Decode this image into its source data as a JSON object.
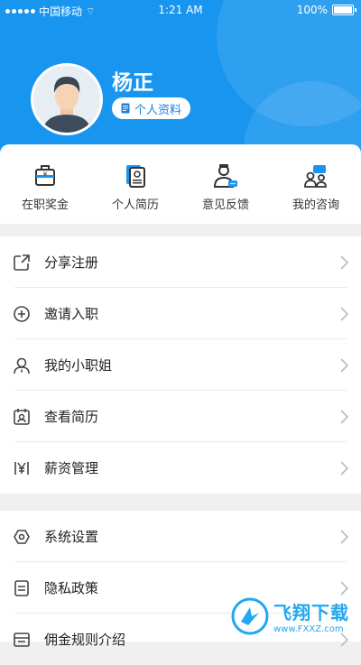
{
  "status_bar": {
    "carrier": "中国移动",
    "time": "1:21 AM",
    "battery": "100%"
  },
  "user": {
    "name": "杨正",
    "profile_button": "个人资料"
  },
  "quick_actions": [
    {
      "label": "在职奖金",
      "icon": "briefcase-yen-icon"
    },
    {
      "label": "个人简历",
      "icon": "resume-icon"
    },
    {
      "label": "意见反馈",
      "icon": "feedback-person-icon"
    },
    {
      "label": "我的咨询",
      "icon": "consult-people-icon"
    }
  ],
  "menu_group_1": [
    {
      "label": "分享注册",
      "icon": "share-icon"
    },
    {
      "label": "邀请入职",
      "icon": "plus-circle-icon"
    },
    {
      "label": "我的小职姐",
      "icon": "person-icon"
    },
    {
      "label": "查看简历",
      "icon": "id-card-icon"
    },
    {
      "label": "薪资管理",
      "icon": "yen-icon"
    }
  ],
  "menu_group_2": [
    {
      "label": "系统设置",
      "icon": "settings-hexagon-icon"
    },
    {
      "label": "隐私政策",
      "icon": "document-icon"
    },
    {
      "label": "佣金规则介绍",
      "icon": "rules-icon"
    }
  ],
  "watermark": {
    "text": "飞翔下载",
    "url": "www.FXXZ.com"
  },
  "colors": {
    "header": "#1896ef",
    "accent": "#1d7fe0",
    "background": "#f0f0f0"
  }
}
